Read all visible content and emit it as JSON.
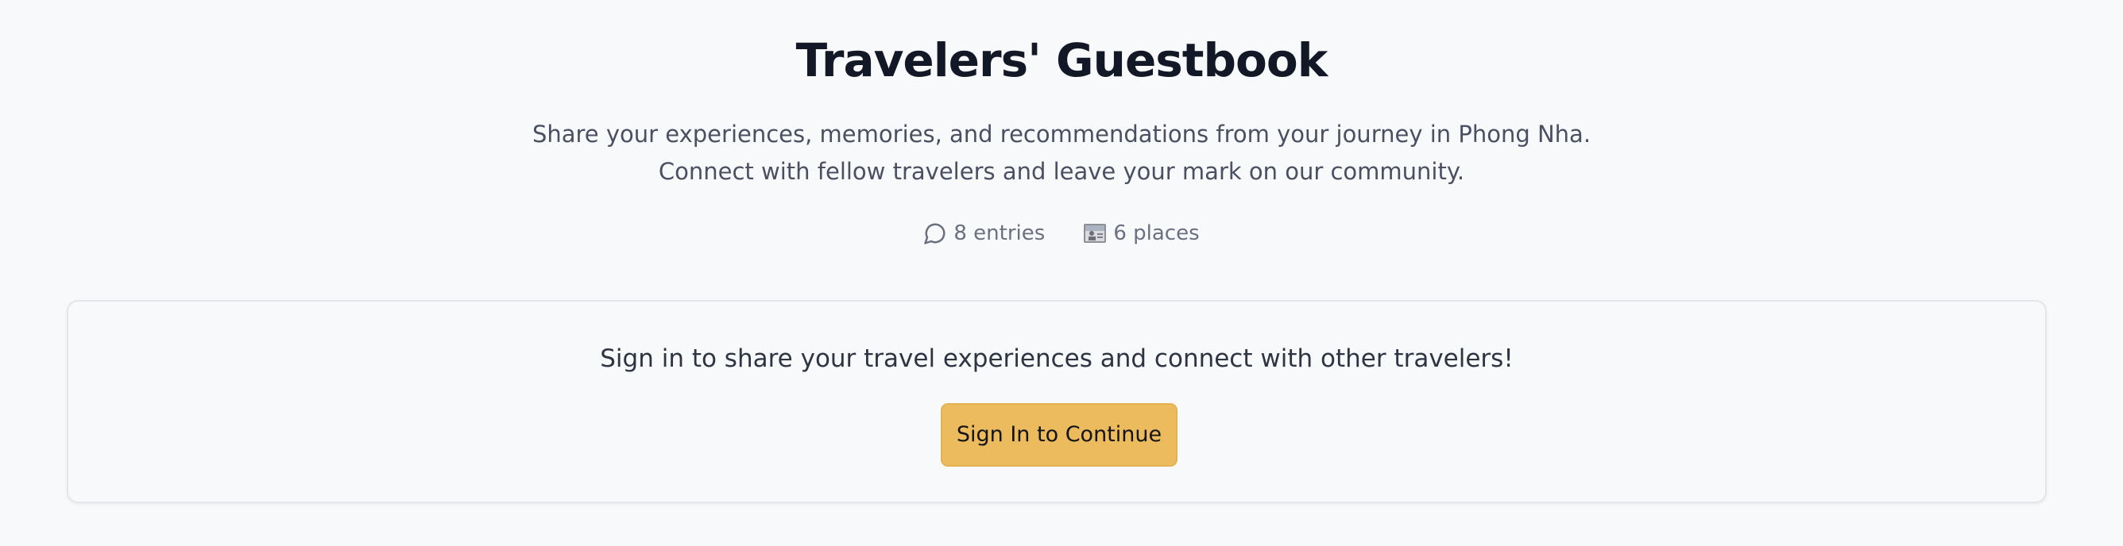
{
  "header": {
    "title": "Travelers' Guestbook",
    "description_line1": "Share your experiences, memories, and recommendations from your journey in Phong Nha.",
    "description_line2": "Connect with fellow travelers and leave your mark on our community."
  },
  "stats": {
    "entries_label": "8 entries",
    "entries_icon": "message-circle-icon",
    "places_label": "6 places",
    "places_icon": "map-image-icon"
  },
  "signin_card": {
    "message": "Sign in to share your travel experiences and connect with other travelers!",
    "button_label": "Sign In to Continue"
  },
  "colors": {
    "background": "#f8f9fb",
    "accent_button": "#ebbb5e",
    "title_text": "#131826",
    "muted_text": "#6b7080"
  }
}
